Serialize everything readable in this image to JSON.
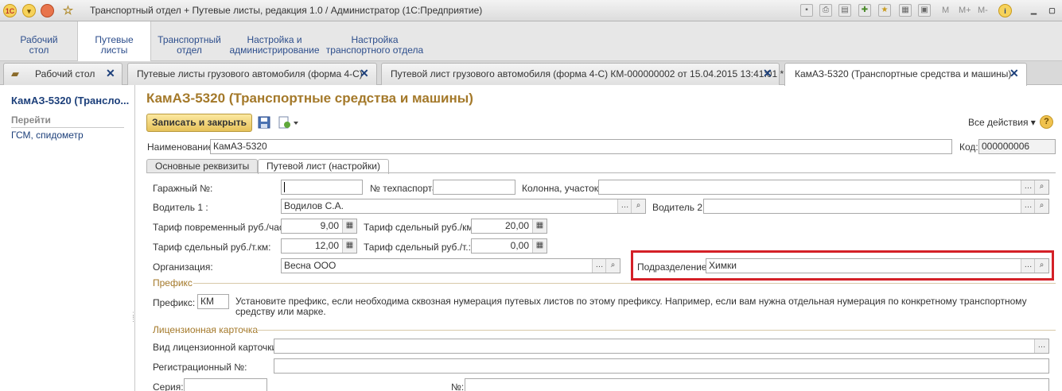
{
  "window": {
    "title": "Транспортный отдел + Путевые листы, редакция 1.0 / Администратор  (1С:Предприятие)",
    "m_buttons": [
      "M",
      "M+",
      "M-"
    ]
  },
  "sections": [
    {
      "line1": "Рабочий",
      "line2": "стол"
    },
    {
      "line1": "Путевые",
      "line2": "листы"
    },
    {
      "line1": "Транспортный",
      "line2": "отдел"
    },
    {
      "line1": "Настройка и",
      "line2": "администрирование"
    },
    {
      "line1": "Настройка",
      "line2": "транспортного отдела"
    }
  ],
  "tabs": [
    {
      "label": "Рабочий стол"
    },
    {
      "label": "Путевые листы грузового автомобиля (форма 4-С)"
    },
    {
      "label": "Путевой лист грузового автомобиля (форма 4-С) КМ-000000002 от 15.04.2015 13:41:01 *"
    },
    {
      "label": "КамАЗ-5320 (Транспортные средства и машины)"
    }
  ],
  "left": {
    "title": "КамАЗ-5320 (Трансло...",
    "section": "Перейти",
    "link": "ГСМ, спидометр"
  },
  "form": {
    "title": "КамАЗ-5320 (Транспортные средства и машины)",
    "save_close": "Записать и закрыть",
    "all_actions": "Все действия",
    "help": "?",
    "name_label": "Наименование:",
    "name_value": "КамАЗ-5320",
    "code_label": "Код:",
    "code_value": "000000006",
    "tab_main": "Основные реквизиты",
    "tab_waybill": "Путевой лист (настройки)",
    "garage_label": "Гаражный №:",
    "garage_value": "",
    "techpass_label": "№ техпаспорта:",
    "techpass_value": "",
    "column_label": "Колонна, участок:",
    "column_value": "",
    "driver1_label": "Водитель 1 :",
    "driver1_value": "Водилов С.А.",
    "driver2_label": "Водитель 2:",
    "driver2_value": "",
    "tariff_time_label": "Тариф повременный руб./час.:",
    "tariff_time_value": "9,00",
    "tariff_piece_km_label": "Тариф сдельный руб./км.:",
    "tariff_piece_km_value": "20,00",
    "tariff_piece_tkm_label": "Тариф сдельный руб./т.км:",
    "tariff_piece_tkm_value": "12,00",
    "tariff_piece_t_label": "Тариф сдельный руб./т.:",
    "tariff_piece_t_value": "0,00",
    "org_label": "Организация:",
    "org_value": "Весна ООО",
    "dept_label": "Подразделение:",
    "dept_value": "Химки",
    "prefix_group": "Префикс",
    "prefix_label": "Префикс:",
    "prefix_value": "КМ",
    "prefix_hint": "Установите префикс, если необходима сквозная нумерация путевых листов по этому префиксу. Например, если вам нужна отдельная нумерация по конкретному  транспортному средству  или марке.",
    "license_group": "Лицензионная карточка",
    "license_type_label": "Вид лицензионной карточки:",
    "license_type_value": "",
    "reg_label": "Регистрационный №:",
    "reg_value": "",
    "series_label": "Серия:",
    "series_value": "",
    "number_label": "№:",
    "number_value": ""
  }
}
